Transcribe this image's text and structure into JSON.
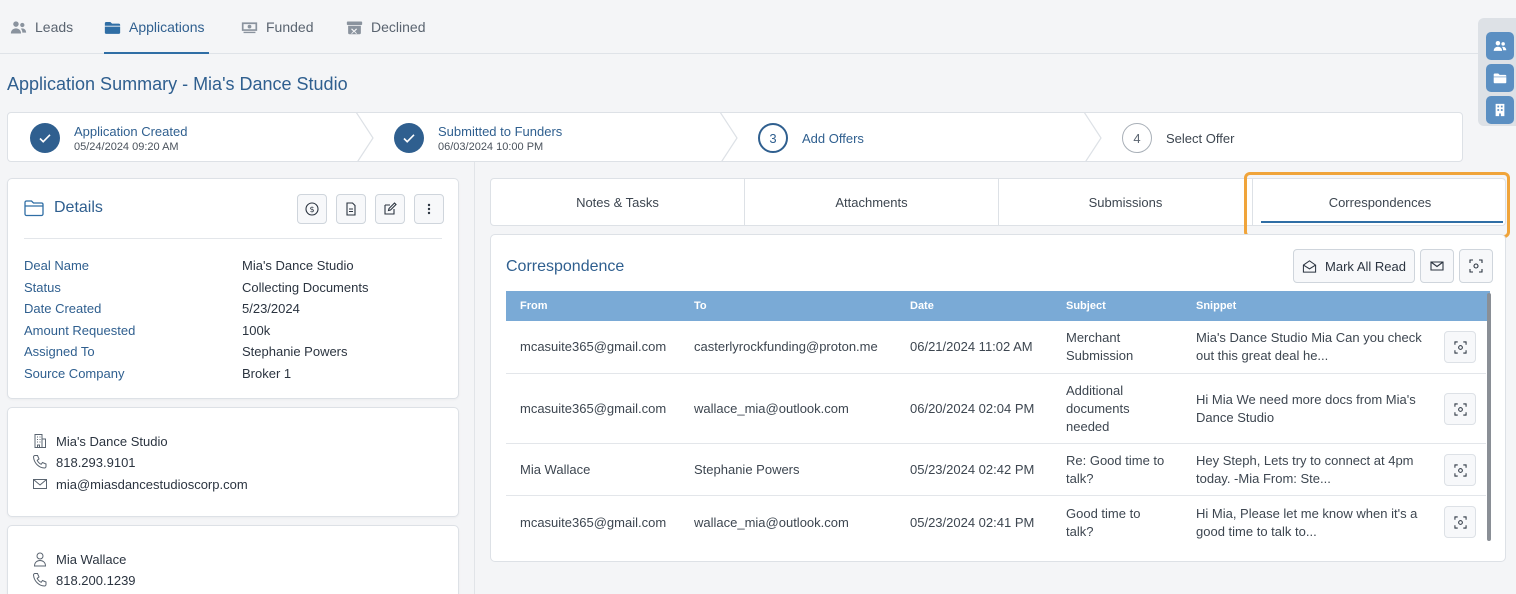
{
  "nav": {
    "tabs": [
      {
        "label": "Leads",
        "icon": "users-icon"
      },
      {
        "label": "Applications",
        "icon": "folder-icon"
      },
      {
        "label": "Funded",
        "icon": "money-icon"
      },
      {
        "label": "Declined",
        "icon": "archive-icon"
      }
    ],
    "active_tab": "Applications"
  },
  "page_title": "Application Summary - Mia's Dance Studio",
  "stepper": {
    "steps": [
      {
        "title": "Application Created",
        "date": "05/24/2024 09:20 AM",
        "state": "done"
      },
      {
        "title": "Submitted to Funders",
        "date": "06/03/2024 10:00 PM",
        "state": "done"
      },
      {
        "number": "3",
        "title": "Add Offers",
        "state": "current"
      },
      {
        "number": "4",
        "title": "Select Offer",
        "state": "pending"
      }
    ]
  },
  "details": {
    "title": "Details",
    "fields": [
      {
        "label": "Deal Name",
        "value": "Mia's Dance Studio"
      },
      {
        "label": "Status",
        "value": "Collecting Documents"
      },
      {
        "label": "Date Created",
        "value": "5/23/2024"
      },
      {
        "label": "Amount Requested",
        "value": "100k"
      },
      {
        "label": "Assigned To",
        "value": "Stephanie Powers"
      },
      {
        "label": "Source Company",
        "value": "Broker 1"
      }
    ]
  },
  "business_contact": {
    "name": "Mia's Dance Studio",
    "phone": "818.293.9101",
    "email": "mia@miasdancestudioscorp.com"
  },
  "person_contact": {
    "name": "Mia Wallace",
    "phone": "818.200.1239"
  },
  "tabs": {
    "items": [
      "Notes & Tasks",
      "Attachments",
      "Submissions",
      "Correspondences"
    ],
    "active": "Correspondences"
  },
  "correspondence": {
    "title": "Correspondence",
    "mark_all_read_label": "Mark All Read",
    "columns": [
      "From",
      "To",
      "Date",
      "Subject",
      "Snippet"
    ],
    "rows": [
      {
        "from": "mcasuite365@gmail.com",
        "to": "casterlyrockfunding@proton.me",
        "date": "06/21/2024 11:02 AM",
        "subject": "Merchant Submission",
        "snippet": "Mia's Dance Studio Mia Can you check out this great deal he..."
      },
      {
        "from": "mcasuite365@gmail.com",
        "to": "wallace_mia@outlook.com",
        "date": "06/20/2024 02:04 PM",
        "subject": "Additional documents needed",
        "snippet": "Hi Mia We need more docs from Mia's Dance Studio"
      },
      {
        "from": "Mia Wallace",
        "to": "Stephanie Powers",
        "date": "05/23/2024 02:42 PM",
        "subject": "Re: Good time to talk?",
        "snippet": "Hey Steph, Lets try to connect at 4pm today. -Mia From: Ste..."
      },
      {
        "from": "mcasuite365@gmail.com",
        "to": "wallace_mia@outlook.com",
        "date": "05/23/2024 02:41 PM",
        "subject": "Good time to talk?",
        "snippet": "Hi Mia, Please let me know when it's a good time to talk to..."
      }
    ]
  },
  "colors": {
    "accent": "#2f6ea5",
    "table_header": "#7aaad6",
    "highlight": "#f0a43a"
  }
}
